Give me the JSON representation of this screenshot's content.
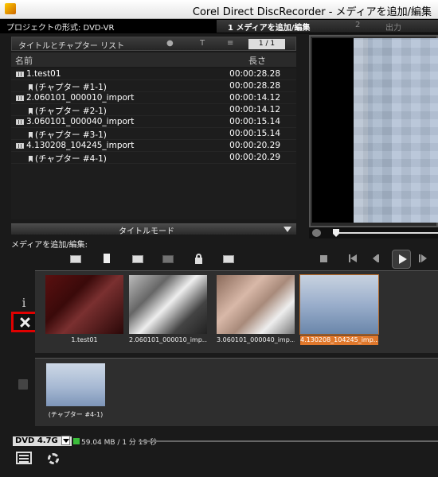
{
  "window": {
    "title": "Corel Direct DiscRecorder - メディアを追加/編集"
  },
  "header": {
    "project_format": "プロジェクトの形式: DVD-VR",
    "steps": [
      {
        "label": "1 メディアを追加/編集",
        "active": true
      },
      {
        "label": "2",
        "active": false
      },
      {
        "label": "出力",
        "active": false
      }
    ]
  },
  "list": {
    "title": "タイトルとチャプター リスト",
    "page": "1 / 1",
    "col_name": "名前",
    "col_length": "長さ",
    "rows": [
      {
        "type": "title",
        "name": "1.test01",
        "duration": "00:00:28.28"
      },
      {
        "type": "chapter",
        "name": "(チャプター #1-1)",
        "duration": "00:00:28.28"
      },
      {
        "type": "title",
        "name": "2.060101_000010_import",
        "duration": "00:00:14.12"
      },
      {
        "type": "chapter",
        "name": "(チャプター #2-1)",
        "duration": "00:00:14.12"
      },
      {
        "type": "title",
        "name": "3.060101_000040_import",
        "duration": "00:00:15.14"
      },
      {
        "type": "chapter",
        "name": "(チャプター #3-1)",
        "duration": "00:00:15.14"
      },
      {
        "type": "title",
        "name": "4.130208_104245_import",
        "duration": "00:00:20.29"
      },
      {
        "type": "chapter",
        "name": "(チャプター #4-1)",
        "duration": "00:00:20.29"
      }
    ],
    "mode_label": "タイトルモード"
  },
  "add_media": {
    "label": "メディアを追加/編集:"
  },
  "thumbnails": [
    {
      "label": "1.test01",
      "selected": false
    },
    {
      "label": "2.060101_000010_imp...",
      "selected": false
    },
    {
      "label": "3.060101_000040_imp...",
      "selected": false
    },
    {
      "label": "4.130208_104245_imp...",
      "selected": true
    }
  ],
  "chapters": [
    {
      "label": "(チャプター #4-1)"
    }
  ],
  "status": {
    "disc": "DVD 4.7G",
    "capacity": "59.04 MB / 1 分 19 秒"
  },
  "colors": {
    "selected": "#e0782c",
    "delete_highlight": "#e00000",
    "capacity": "#3bbd3b"
  }
}
